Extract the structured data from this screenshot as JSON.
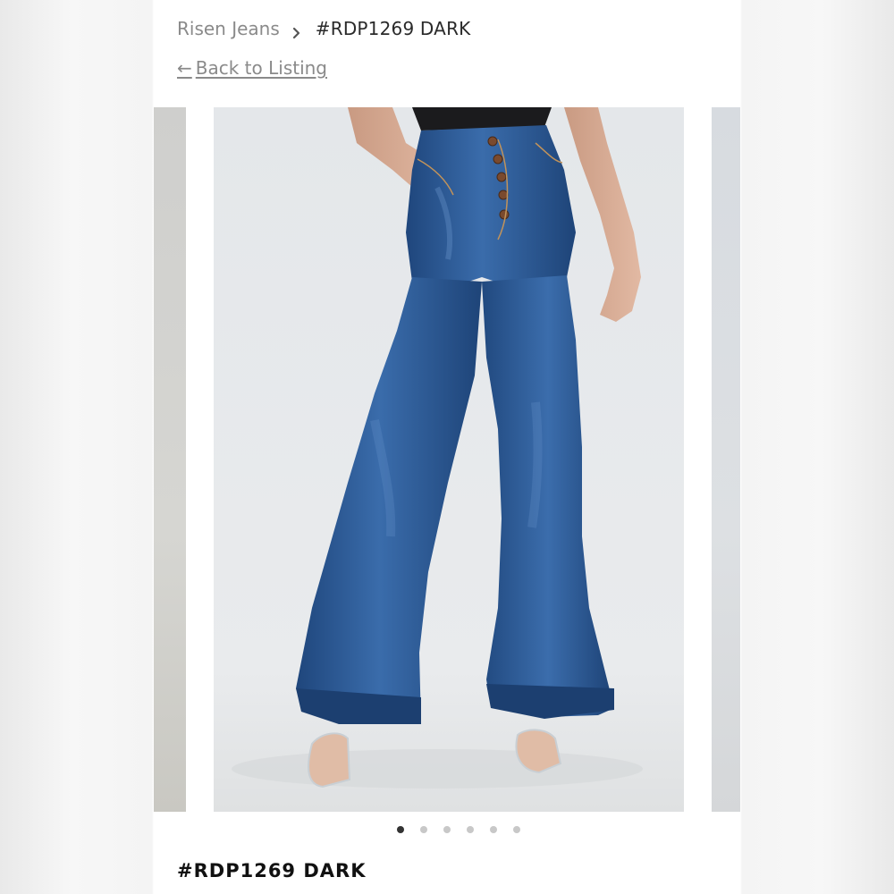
{
  "breadcrumb": {
    "brand": "Risen Jeans",
    "current": "#RDP1269 DARK"
  },
  "back_link": {
    "arrow": "←",
    "label": "Back to Listing"
  },
  "carousel": {
    "slide_count": 6,
    "active_index": 0,
    "image_subject": "dark-wash-flare-jeans-photo"
  },
  "product": {
    "title": "#RDP1269 DARK"
  },
  "colors": {
    "denim": "#2c5a95",
    "text_muted": "#8a8a8a",
    "dot_active": "#333333",
    "dot_inactive": "#c8c8c8"
  },
  "icons": {
    "breadcrumb_separator": "chevron-right-icon",
    "back": "arrow-left-icon"
  }
}
